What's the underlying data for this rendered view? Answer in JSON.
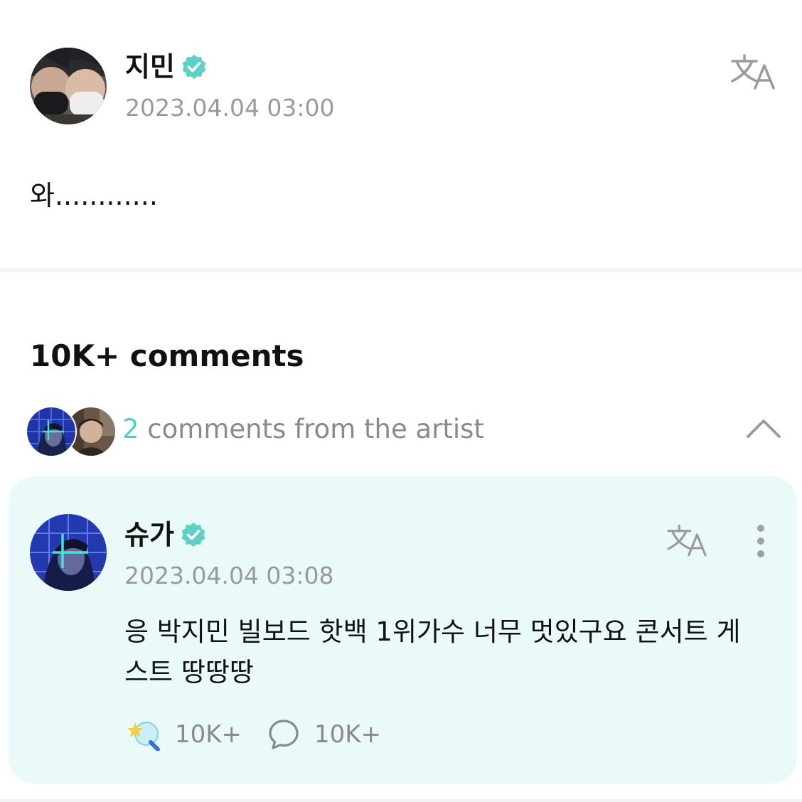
{
  "post": {
    "author": "지민",
    "timestamp": "2023.04.04 03:00",
    "body": "와............"
  },
  "comments": {
    "title": "10K+ comments",
    "artist_count": "2",
    "artist_label": " comments from the artist"
  },
  "artist_comment": {
    "author": "슈가",
    "timestamp": "2023.04.04 03:08",
    "body": "응 박지민 빌보드 핫백 1위가수 너무 멋있구요 콘서트 게스트 땅땅땅",
    "likes": "10K+",
    "replies": "10K+"
  },
  "colors": {
    "accent": "#4fcfc4",
    "card_bg": "#e9faf8",
    "muted": "#9a9a9a"
  },
  "icons": [
    "verified-badge-icon",
    "translate-icon",
    "chevron-up-icon",
    "more-vertical-icon",
    "reaction-icon",
    "comment-bubble-icon"
  ]
}
